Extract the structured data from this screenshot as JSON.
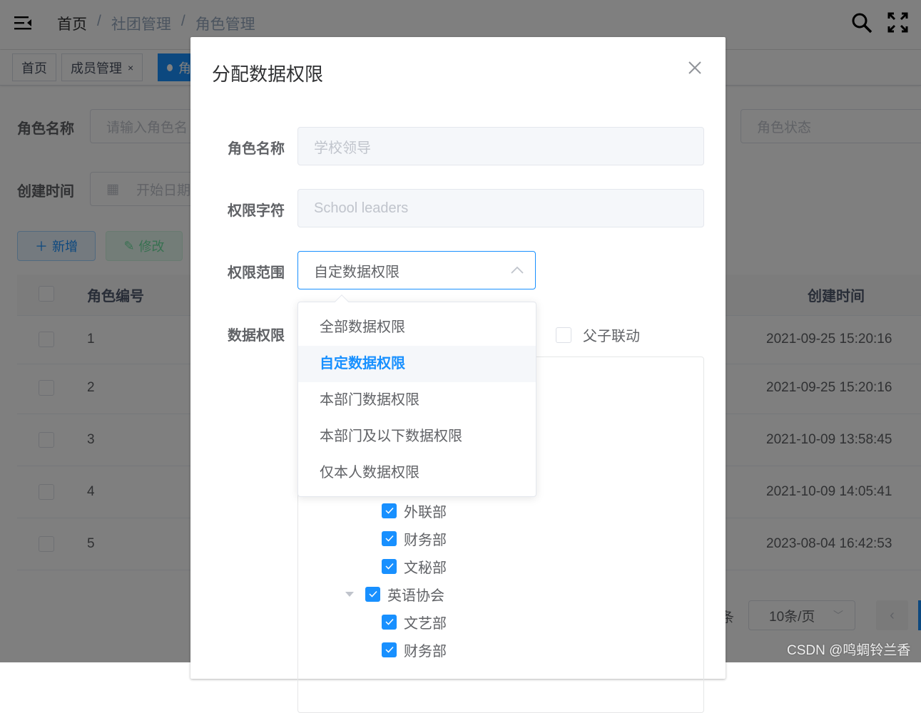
{
  "header": {
    "breadcrumb": [
      "首页",
      "社团管理",
      "角色管理"
    ]
  },
  "tags": [
    {
      "label": "首页"
    },
    {
      "label": "成员管理"
    },
    {
      "label": "角"
    }
  ],
  "search": {
    "role_name_label": "角色名称",
    "role_name_placeholder": "请输入角色名",
    "created_label": "创建时间",
    "start_date_placeholder": "开始日期",
    "status_placeholder": "角色状态"
  },
  "toolbar": {
    "add": "新增",
    "edit": "修改"
  },
  "table": {
    "headers": {
      "id": "角色编号",
      "created": "创建时间"
    },
    "rows": [
      {
        "id": "1",
        "created": "2021-09-25 15:20:16"
      },
      {
        "id": "2",
        "created": "2021-09-25 15:20:16"
      },
      {
        "id": "3",
        "created": "2021-10-09 13:58:45"
      },
      {
        "id": "4",
        "created": "2021-10-09 14:05:41"
      },
      {
        "id": "5",
        "created": "2023-08-04 16:42:53"
      }
    ]
  },
  "pagination": {
    "total_suffix": "条",
    "page_size": "10条/页"
  },
  "watermark": "CSDN @鸣蜩铃兰香",
  "dialog": {
    "title": "分配数据权限",
    "role_name_label": "角色名称",
    "role_name_value": "学校领导",
    "role_key_label": "权限字符",
    "role_key_value": "School leaders",
    "scope_label": "权限范围",
    "scope_value": "自定数据权限",
    "data_label": "数据权限",
    "linkage_label": "父子联动",
    "scope_options": [
      "全部数据权限",
      "自定数据权限",
      "本部门数据权限",
      "本部门及以下数据权限",
      "仅本人数据权限"
    ],
    "tree": [
      {
        "label": "外联部",
        "level": 2
      },
      {
        "label": "财务部",
        "level": 2
      },
      {
        "label": "文秘部",
        "level": 2
      },
      {
        "label": "英语协会",
        "level": 1,
        "expanded": true
      },
      {
        "label": "文艺部",
        "level": 2
      },
      {
        "label": "财务部",
        "level": 2
      }
    ]
  },
  "colors": {
    "primary": "#1890ff",
    "success": "#13ce66"
  }
}
